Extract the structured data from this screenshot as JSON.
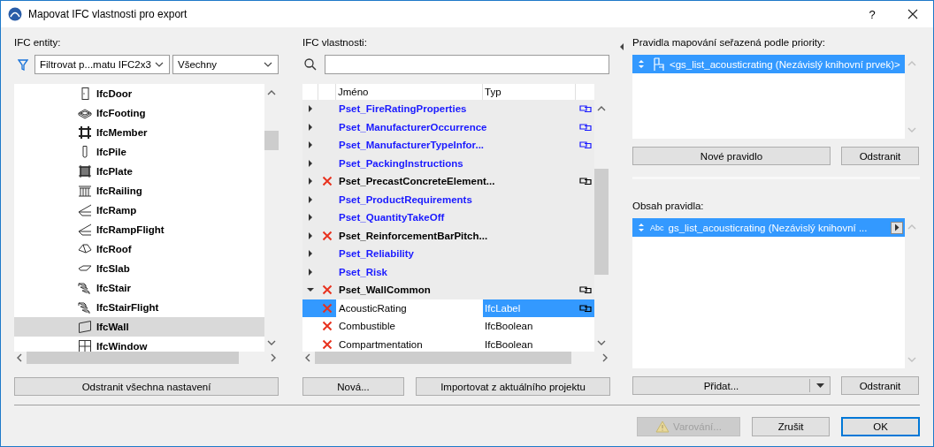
{
  "window": {
    "title": "Mapovat IFC vlastnosti pro export",
    "help": "?"
  },
  "entities": {
    "label": "IFC entity:",
    "filter": "Filtrovat p...matu IFC2x3",
    "scope": "Všechny",
    "button": "Odstranit všechna nastavení",
    "items": [
      {
        "kind": "door",
        "name": "IfcDoor",
        "selected": false
      },
      {
        "kind": "footing",
        "name": "IfcFooting",
        "selected": false
      },
      {
        "kind": "member",
        "name": "IfcMember",
        "selected": false
      },
      {
        "kind": "pile",
        "name": "IfcPile",
        "selected": false
      },
      {
        "kind": "plate",
        "name": "IfcPlate",
        "selected": false
      },
      {
        "kind": "railing",
        "name": "IfcRailing",
        "selected": false
      },
      {
        "kind": "ramp",
        "name": "IfcRamp",
        "selected": false
      },
      {
        "kind": "ramp",
        "name": "IfcRampFlight",
        "selected": false
      },
      {
        "kind": "roof",
        "name": "IfcRoof",
        "selected": false
      },
      {
        "kind": "slab",
        "name": "IfcSlab",
        "selected": false
      },
      {
        "kind": "stair",
        "name": "IfcStair",
        "selected": false
      },
      {
        "kind": "stair",
        "name": "IfcStairFlight",
        "selected": false
      },
      {
        "kind": "wall",
        "name": "IfcWall",
        "selected": true
      },
      {
        "kind": "window",
        "name": "IfcWindow",
        "selected": false
      }
    ]
  },
  "properties": {
    "label": "IFC vlastnosti:",
    "columns": [
      "Jméno",
      "Typ"
    ],
    "buttons": [
      "Nová...",
      "Importovat z aktuálního projektu"
    ],
    "rows": [
      {
        "kind": "group",
        "name": "Pset_FireRatingProperties",
        "expanded": false,
        "error": false,
        "color": "#1a1aff",
        "linked": true,
        "selected": false
      },
      {
        "kind": "group",
        "name": "Pset_ManufacturerOccurrence",
        "expanded": false,
        "error": false,
        "color": "#1a1aff",
        "linked": true,
        "selected": false
      },
      {
        "kind": "group",
        "name": "Pset_ManufacturerTypeInfor...",
        "expanded": false,
        "error": false,
        "color": "#1a1aff",
        "linked": true,
        "selected": false
      },
      {
        "kind": "group",
        "name": "Pset_PackingInstructions",
        "expanded": false,
        "error": false,
        "color": "#1a1aff",
        "linked": false,
        "selected": false
      },
      {
        "kind": "group",
        "name": "Pset_PrecastConcreteElement...",
        "expanded": false,
        "error": true,
        "color": "#000000",
        "linked": true,
        "selected": false
      },
      {
        "kind": "group",
        "name": "Pset_ProductRequirements",
        "expanded": false,
        "error": false,
        "color": "#1a1aff",
        "linked": false,
        "selected": false
      },
      {
        "kind": "group",
        "name": "Pset_QuantityTakeOff",
        "expanded": false,
        "error": false,
        "color": "#1a1aff",
        "linked": false,
        "selected": false
      },
      {
        "kind": "group",
        "name": "Pset_ReinforcementBarPitch...",
        "expanded": false,
        "error": true,
        "color": "#000000",
        "linked": false,
        "selected": false
      },
      {
        "kind": "group",
        "name": "Pset_Reliability",
        "expanded": false,
        "error": false,
        "color": "#1a1aff",
        "linked": false,
        "selected": false
      },
      {
        "kind": "group",
        "name": "Pset_Risk",
        "expanded": false,
        "error": false,
        "color": "#1a1aff",
        "linked": false,
        "selected": false
      },
      {
        "kind": "group",
        "name": "Pset_WallCommon",
        "expanded": true,
        "error": true,
        "color": "#000000",
        "linked": true,
        "selected": false
      },
      {
        "kind": "property",
        "name": "AcousticRating",
        "type": "IfcLabel",
        "error": true,
        "linked": true,
        "selected": true
      },
      {
        "kind": "property",
        "name": "Combustible",
        "type": "IfcBoolean",
        "error": true,
        "linked": false,
        "selected": false
      },
      {
        "kind": "property",
        "name": "Compartmentation",
        "type": "IfcBoolean",
        "error": true,
        "linked": false,
        "selected": false
      }
    ]
  },
  "rules": {
    "label": "Pravidla mapování seřazená podle priority:",
    "buttons": [
      "Nové pravidlo",
      "Odstranit"
    ],
    "items": [
      {
        "text": "<gs_list_acousticrating (Nezávislý knihovní prvek)>",
        "selected": true
      }
    ]
  },
  "content": {
    "label": "Obsah pravidla:",
    "add_button": "Přidat...",
    "remove_button": "Odstranit",
    "items": [
      {
        "type_label": "Abc",
        "text": "gs_list_acousticrating (Nezávislý knihovní ...",
        "selected": true
      }
    ]
  },
  "footer": {
    "buttons": [
      {
        "kind": "warning",
        "label": "Varování...",
        "disabled": true,
        "default": false
      },
      {
        "kind": "plain",
        "label": "Zrušit",
        "disabled": false,
        "default": false
      },
      {
        "kind": "plain",
        "label": "OK",
        "disabled": false,
        "default": true
      }
    ]
  }
}
